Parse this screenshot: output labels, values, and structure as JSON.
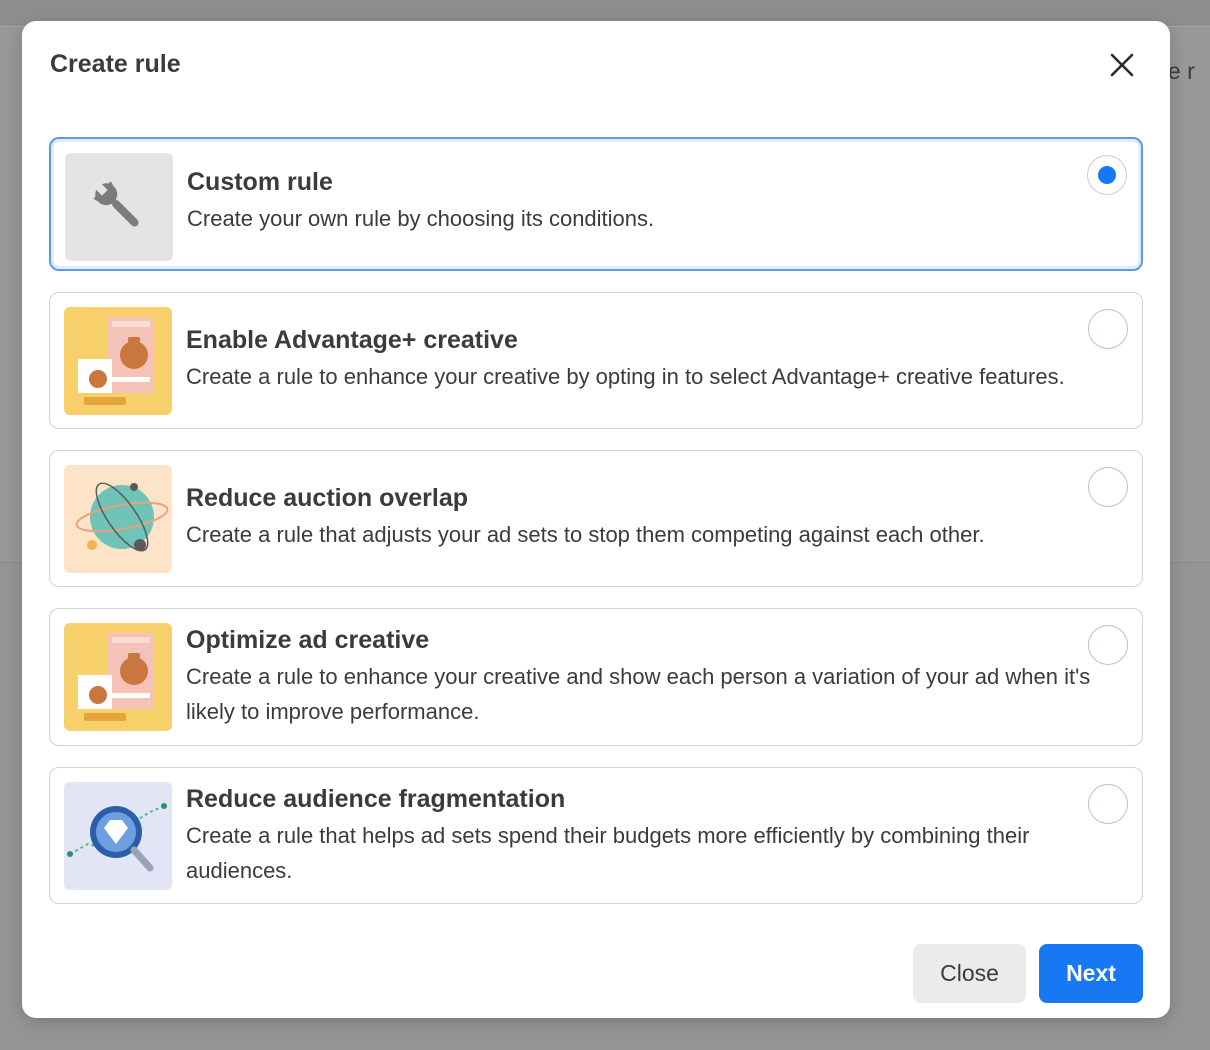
{
  "background": {
    "peek_text": "ule r"
  },
  "modal": {
    "title": "Create rule",
    "close_icon": "close-icon"
  },
  "options": [
    {
      "title": "Custom rule",
      "description": "Create your own rule by choosing its conditions.",
      "icon": "wrench-icon",
      "selected": true
    },
    {
      "title": "Enable Advantage+ creative",
      "description": "Create a rule to enhance your creative by opting in to select Advantage+ creative features.",
      "icon": "teapot-creative-illustration",
      "selected": false
    },
    {
      "title": "Reduce auction overlap",
      "description": "Create a rule that adjusts your ad sets to stop them competing against each other.",
      "icon": "globe-orbit-illustration",
      "selected": false
    },
    {
      "title": "Optimize ad creative",
      "description": "Create a rule to enhance your creative and show each person a variation of your ad when it's likely to improve performance.",
      "icon": "teapot-creative-illustration",
      "selected": false
    },
    {
      "title": "Reduce audience fragmentation",
      "description": "Create a rule that helps ad sets spend their budgets more efficiently by combining their audiences.",
      "icon": "diamond-magnifier-illustration",
      "selected": false
    }
  ],
  "footer": {
    "close_label": "Close",
    "next_label": "Next"
  },
  "colors": {
    "accent": "#1877f2",
    "selected_border": "#5a9be6"
  }
}
